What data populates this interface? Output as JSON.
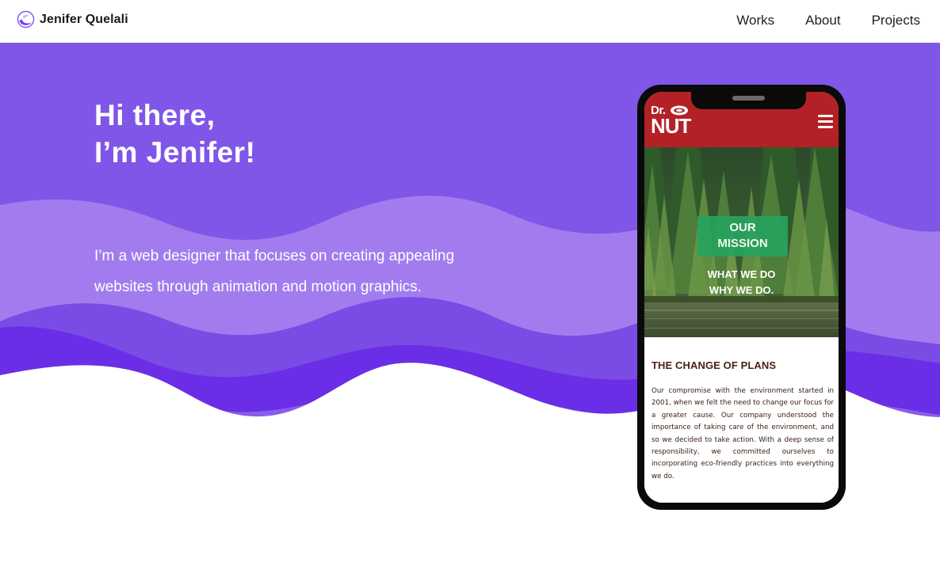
{
  "header": {
    "brand_name": "Jenifer Quelali",
    "nav": [
      "Works",
      "About",
      "Projects"
    ]
  },
  "hero": {
    "greeting_line1": "Hi there,",
    "greeting_line2": "I’m Jenifer!",
    "intro": "I’m a web designer that focuses on creating appealing websites through animation and motion graphics."
  },
  "phone_preview": {
    "logo_line1": "Dr.",
    "logo_line2": "NUT",
    "mission_line1": "OUR",
    "mission_line2": "MISSION",
    "tagline_line1": "WHAT WE DO",
    "tagline_line2": "WHY WE DO.",
    "section_title": "THE CHANGE OF PLANS",
    "section_text": "Our compromise with the environment started in 2001, when we felt the need to change our focus for a greater cause. Our company understood the importance of taking care of the environment, and so we decided to take action. With a deep sense of responsibility, we committed ourselves to incorporating eco-friendly practices into everything we do."
  },
  "colors": {
    "accent_purple": "#7f56e8",
    "wave_light": "#a27cee",
    "wave_dark": "#6a2ee6",
    "brand_red": "#b32026",
    "badge_green": "#27a35d"
  },
  "icons": [
    "brand-logo-icon",
    "nut-icon",
    "menu-icon"
  ]
}
